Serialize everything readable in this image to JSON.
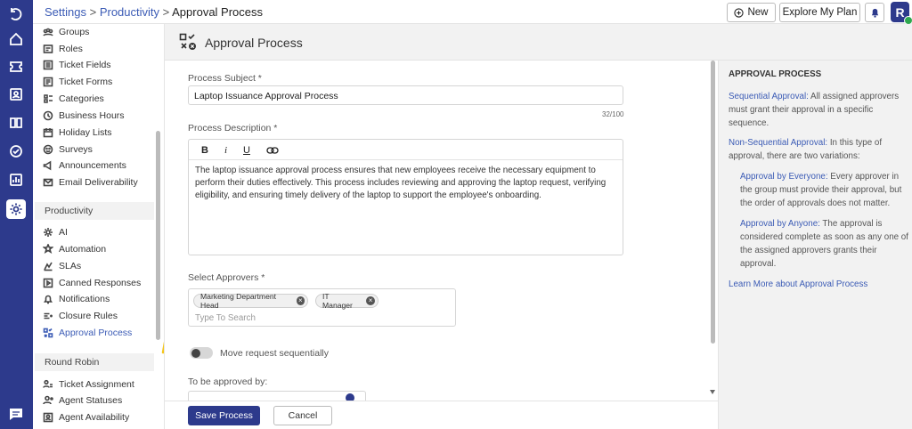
{
  "breadcrumb": {
    "part1": "Settings",
    "sep1": " > ",
    "part2": "Productivity",
    "sep2": " > ",
    "current": "Approval Process"
  },
  "topbar": {
    "new_label": "New",
    "plan_label": "Explore My Plan",
    "avatar_initial": "R"
  },
  "sidebar": {
    "items_top": [
      {
        "label": "Groups",
        "icon": "groups-icon"
      },
      {
        "label": "Roles",
        "icon": "roles-icon"
      },
      {
        "label": "Ticket Fields",
        "icon": "ticket-fields-icon"
      },
      {
        "label": "Ticket Forms",
        "icon": "ticket-forms-icon"
      },
      {
        "label": "Categories",
        "icon": "categories-icon"
      },
      {
        "label": "Business Hours",
        "icon": "clock-icon"
      },
      {
        "label": "Holiday Lists",
        "icon": "calendar-icon"
      },
      {
        "label": "Surveys",
        "icon": "survey-icon"
      },
      {
        "label": "Announcements",
        "icon": "megaphone-icon"
      },
      {
        "label": "Email Deliverability",
        "icon": "mail-icon"
      }
    ],
    "group_productivity": "Productivity",
    "items_productivity": [
      {
        "label": "AI",
        "icon": "ai-gear-icon"
      },
      {
        "label": "Automation",
        "icon": "automation-icon"
      },
      {
        "label": "SLAs",
        "icon": "sla-icon"
      },
      {
        "label": "Canned Responses",
        "icon": "canned-icon"
      },
      {
        "label": "Notifications",
        "icon": "bell-icon"
      },
      {
        "label": "Closure Rules",
        "icon": "closure-icon"
      },
      {
        "label": "Approval Process",
        "icon": "approval-icon"
      }
    ],
    "group_round_robin": "Round Robin",
    "items_round_robin": [
      {
        "label": "Ticket Assignment",
        "icon": "assignment-icon"
      },
      {
        "label": "Agent Statuses",
        "icon": "status-icon"
      },
      {
        "label": "Agent Availability",
        "icon": "availability-icon"
      }
    ]
  },
  "page": {
    "title": "Approval Process"
  },
  "form": {
    "subject_label": "Process Subject *",
    "subject_value": "Laptop Issuance Approval Process",
    "subject_count": "32/100",
    "description_label": "Process Description *",
    "toolbar": {
      "bold": "B",
      "italic": "i",
      "underline": "U"
    },
    "description_text": "The laptop issuance approval process ensures that new employees receive the necessary equipment to perform their duties effectively. This process includes reviewing and approving the laptop request, verifying eligibility, and ensuring timely delivery of the laptop to support the employee's onboarding.",
    "approvers_label": "Select Approvers *",
    "approvers": [
      "Marketing Department Head",
      "IT Manager"
    ],
    "approvers_placeholder": "Type To Search",
    "sequential_toggle_label": "Move request sequentially",
    "to_be_approved_label": "To be approved by:"
  },
  "footer": {
    "save_label": "Save Process",
    "cancel_label": "Cancel"
  },
  "help": {
    "heading": "APPROVAL PROCESS",
    "seq_title": "Sequential Approval:",
    "seq_text": " All assigned approvers must grant their approval in a specific sequence.",
    "nonseq_title": "Non-Sequential Approval:",
    "nonseq_text": " In this type of approval, there are two variations:",
    "everyone_title": "Approval by Everyone:",
    "everyone_text": " Every approver in the group must provide their approval, but the order of approvals does not matter.",
    "anyone_title": "Approval by Anyone:",
    "anyone_text": " The approval is considered complete as soon as any one of the assigned approvers grants their approval.",
    "learn_more": "Learn More about Approval Process"
  },
  "colors": {
    "brand": "#2d3a8c",
    "link": "#3b5bb5",
    "panel_bg": "#f2f2f2",
    "arrow": "#f5c518"
  }
}
